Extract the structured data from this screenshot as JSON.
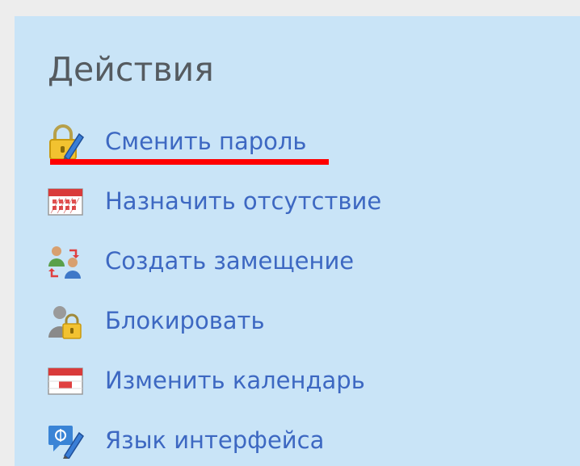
{
  "actions_panel": {
    "title": "Действия",
    "highlight_color": "#ff0000",
    "items": [
      {
        "label": "Сменить пароль",
        "icon": "lock-pencil-icon"
      },
      {
        "label": "Назначить отсутствие",
        "icon": "calendar-absence-icon"
      },
      {
        "label": "Создать замещение",
        "icon": "users-swap-icon"
      },
      {
        "label": "Блокировать",
        "icon": "user-lock-icon"
      },
      {
        "label": "Изменить календарь",
        "icon": "calendar-icon"
      },
      {
        "label": "Язык интерфейса",
        "icon": "language-pencil-icon"
      }
    ]
  }
}
